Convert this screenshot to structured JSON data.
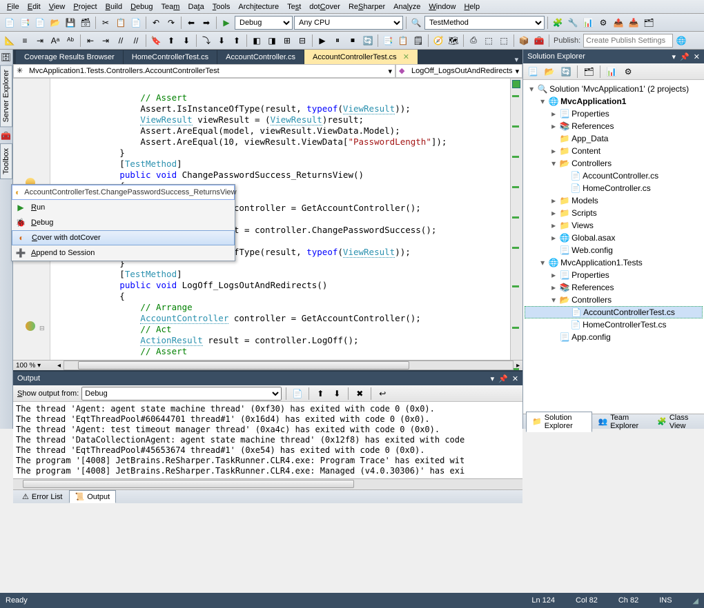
{
  "menu": [
    "File",
    "Edit",
    "View",
    "Project",
    "Build",
    "Debug",
    "Team",
    "Data",
    "Tools",
    "Architecture",
    "Test",
    "dotCover",
    "ReSharper",
    "Analyze",
    "Window",
    "Help"
  ],
  "menu_accel": [
    0,
    0,
    0,
    0,
    0,
    0,
    3,
    2,
    0,
    4,
    2,
    3,
    2,
    3,
    0,
    0
  ],
  "toolbar1": {
    "debug_label": "Debug",
    "platform_label": "Any CPU",
    "start_label": "TestMethod",
    "publish_label": "Publish:",
    "publish_placeholder": "Create Publish Settings"
  },
  "tabs": [
    "Coverage Results Browser",
    "HomeControllerTest.cs",
    "AccountController.cs",
    "AccountControllerTest.cs"
  ],
  "active_tab": 3,
  "nav_left": "MvcApplication1.Tests.Controllers.AccountControllerTest",
  "nav_right": "LogOff_LogsOutAndRedirects",
  "zoom": "100 %",
  "ctx": {
    "header": "AccountControllerTest.ChangePasswordSuccess_ReturnsView",
    "items": [
      {
        "label": "Run",
        "accel": 0,
        "ico": "▶",
        "color": "#2a912a"
      },
      {
        "label": "Debug",
        "accel": 0,
        "ico": "🐞",
        "color": ""
      },
      {
        "label": "Cover  with dotCover",
        "accel": 0,
        "ico": "◐",
        "color": "#d46a1a",
        "sel": true
      },
      {
        "label": "Append to Session",
        "accel": 0,
        "ico": "➕",
        "color": "#2a7a2a"
      }
    ]
  },
  "code": [
    {
      "t": "",
      "i": 16
    },
    {
      "t": "// Assert",
      "i": 16,
      "cls": "cm"
    },
    {
      "html": "Assert.IsInstanceOfType(result, <span class='kw'>typeof</span>(<span class='ty ul'>ViewResult</span>));",
      "i": 16
    },
    {
      "html": "<span class='ty ul'>ViewResult</span> viewResult = (<span class='ty ul'>ViewResult</span>)result;",
      "i": 16
    },
    {
      "html": "Assert.AreEqual(model, viewResult.ViewData.Model);",
      "i": 16
    },
    {
      "html": "Assert.AreEqual(10, viewResult.ViewData[<span class='st'>\"PasswordLength\"</span>]);",
      "i": 16
    },
    {
      "t": "}",
      "i": 12
    },
    {
      "t": "",
      "i": 0
    },
    {
      "html": "[<span class='at'>TestMethod</span>]",
      "i": 12
    },
    {
      "html": "<span class='kw'>public</span> <span class='kw'>void</span> ChangePasswordSuccess_ReturnsView()",
      "i": 12
    },
    {
      "t": "{",
      "i": 12
    },
    {
      "t": "// Arrange",
      "i": 16,
      "cls": "cm"
    },
    {
      "html": "<span class='ty ul'>AccountController</span> controller = GetAccountController();",
      "i": 16
    },
    {
      "t": "",
      "i": 0
    },
    {
      "t": "// Act",
      "i": 16,
      "cls": "cm"
    },
    {
      "html": "<span class='ty ul'>ActionResult</span> result = controller.ChangePasswordSuccess();",
      "i": 16
    },
    {
      "t": "",
      "i": 0
    },
    {
      "t": "// Assert",
      "i": 16,
      "cls": "cm"
    },
    {
      "html": "Assert.IsInstanceOfType(result, <span class='kw'>typeof</span>(<span class='ty ul'>ViewResult</span>));",
      "i": 16
    },
    {
      "t": "}",
      "i": 12
    },
    {
      "t": "",
      "i": 0
    },
    {
      "html": "[<span class='at'>TestMethod</span>]",
      "i": 12
    },
    {
      "html": "<span class='kw'>public</span> <span class='kw'>void</span> LogOff_LogsOutAndRedirects()",
      "i": 12
    },
    {
      "t": "{",
      "i": 12
    },
    {
      "t": "// Arrange",
      "i": 16,
      "cls": "cm"
    },
    {
      "html": "<span class='ty ul'>AccountController</span> controller = GetAccountController();",
      "i": 16
    },
    {
      "t": "",
      "i": 0
    },
    {
      "t": "// Act",
      "i": 16,
      "cls": "cm"
    },
    {
      "html": "<span class='ty ul'>ActionResult</span> result = controller.LogOff();",
      "i": 16
    },
    {
      "t": "",
      "i": 0
    },
    {
      "t": "// Assert",
      "i": 16,
      "cls": "cm"
    }
  ],
  "output": {
    "title": "Output",
    "show_label": "Show output from:",
    "source": "Debug",
    "lines": [
      "The thread 'Agent: agent state machine thread' (0xf30) has exited with code 0 (0x0).",
      "The thread 'EqtThreadPool#60644701 thread#1' (0x16d4) has exited with code 0 (0x0).",
      "The thread 'Agent: test timeout manager thread' (0xa4c) has exited with code 0 (0x0).",
      "The thread 'DataCollectionAgent: agent state machine thread' (0x12f8) has exited with code",
      "The thread 'EqtThreadPool#45653674 thread#1' (0xe54) has exited with code 0 (0x0).",
      "The program '[4008] JetBrains.ReSharper.TaskRunner.CLR4.exe: Program Trace' has exited wit",
      "The program '[4008] JetBrains.ReSharper.TaskRunner.CLR4.exe: Managed (v4.0.30306)' has exi"
    ],
    "tabs": [
      "Error List",
      "Output"
    ],
    "active_tab": 1
  },
  "sol": {
    "title": "Solution Explorer",
    "root": "Solution 'MvcApplication1' (2 projects)",
    "tabs": [
      "Solution Explorer",
      "Team Explorer",
      "Class View"
    ],
    "active_tab": 0,
    "tree": [
      {
        "d": 0,
        "tw": "▾",
        "ico": "🔍",
        "lbl": "Solution 'MvcApplication1' (2 projects)"
      },
      {
        "d": 1,
        "tw": "▾",
        "ico": "🌐",
        "lbl": "MvcApplication1",
        "bold": true
      },
      {
        "d": 2,
        "tw": "▸",
        "ico": "📃",
        "lbl": "Properties"
      },
      {
        "d": 2,
        "tw": "▸",
        "ico": "📚",
        "lbl": "References"
      },
      {
        "d": 2,
        "tw": "",
        "ico": "📁",
        "lbl": "App_Data"
      },
      {
        "d": 2,
        "tw": "▸",
        "ico": "📁",
        "lbl": "Content"
      },
      {
        "d": 2,
        "tw": "▾",
        "ico": "📂",
        "lbl": "Controllers"
      },
      {
        "d": 3,
        "tw": "",
        "ico": "📄",
        "lbl": "AccountController.cs",
        "cs": true
      },
      {
        "d": 3,
        "tw": "",
        "ico": "📄",
        "lbl": "HomeController.cs",
        "cs": true
      },
      {
        "d": 2,
        "tw": "▸",
        "ico": "📁",
        "lbl": "Models"
      },
      {
        "d": 2,
        "tw": "▸",
        "ico": "📁",
        "lbl": "Scripts"
      },
      {
        "d": 2,
        "tw": "▸",
        "ico": "📁",
        "lbl": "Views"
      },
      {
        "d": 2,
        "tw": "▸",
        "ico": "🌐",
        "lbl": "Global.asax"
      },
      {
        "d": 2,
        "tw": "",
        "ico": "📃",
        "lbl": "Web.config"
      },
      {
        "d": 1,
        "tw": "▾",
        "ico": "🌐",
        "lbl": "MvcApplication1.Tests"
      },
      {
        "d": 2,
        "tw": "▸",
        "ico": "📃",
        "lbl": "Properties"
      },
      {
        "d": 2,
        "tw": "▸",
        "ico": "📚",
        "lbl": "References"
      },
      {
        "d": 2,
        "tw": "▾",
        "ico": "📂",
        "lbl": "Controllers"
      },
      {
        "d": 3,
        "tw": "",
        "ico": "📄",
        "lbl": "AccountControllerTest.cs",
        "cs": true,
        "sel": true
      },
      {
        "d": 3,
        "tw": "",
        "ico": "📄",
        "lbl": "HomeControllerTest.cs",
        "cs": true
      },
      {
        "d": 2,
        "tw": "",
        "ico": "📃",
        "lbl": "App.config"
      }
    ]
  },
  "status": {
    "ready": "Ready",
    "ln": "Ln 124",
    "col": "Col 82",
    "ch": "Ch 82",
    "ins": "INS"
  },
  "sidebar": {
    "server": "Server Explorer",
    "toolbox": "Toolbox"
  }
}
